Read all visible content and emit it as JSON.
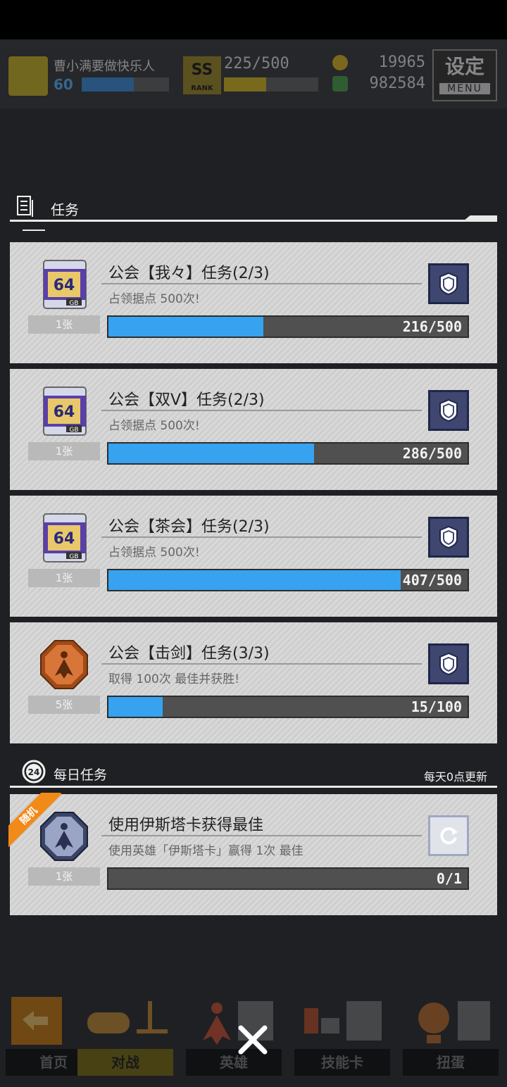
{
  "header": {
    "user_name": "曹小满要做快乐人",
    "level": "60",
    "rank_badge": "SS",
    "rank_label": "RANK",
    "rank_progress": "225/500",
    "coins": "19965",
    "gems": "982584",
    "settings_label": "设定",
    "settings_sub": "MENU"
  },
  "section": {
    "title": "任务"
  },
  "tasks": [
    {
      "title": "公会【我々】任务(2/3)",
      "desc": "占领据点 500次!",
      "reward_count": "1张",
      "progress_text": "216/500",
      "progress": 0.432,
      "reward_type": "gb-card-icon"
    },
    {
      "title": "公会【双V】任务(2/3)",
      "desc": "占领据点 500次!",
      "reward_count": "1张",
      "progress_text": "286/500",
      "progress": 0.572,
      "reward_type": "gb-card-icon"
    },
    {
      "title": "公会【茶会】任务(2/3)",
      "desc": "占领据点 500次!",
      "reward_count": "1张",
      "progress_text": "407/500",
      "progress": 0.814,
      "reward_type": "gb-card-icon"
    },
    {
      "title": "公会【击剑】任务(3/3)",
      "desc": "取得 100次 最佳并获胜!",
      "reward_count": "5张",
      "progress_text": "15/100",
      "progress": 0.15,
      "reward_type": "bronze-medal-icon"
    }
  ],
  "daily": {
    "title": "每日任务",
    "note": "每天0点更新",
    "task": {
      "ribbon": "随机",
      "title": "使用伊斯塔卡获得最佳",
      "desc": "使用英雄「伊斯塔卡」赢得 1次 最佳",
      "reward_count": "1张",
      "progress_text": "0/1",
      "progress": 0
    }
  },
  "nav": [
    {
      "label": "首页"
    },
    {
      "label": "对战"
    },
    {
      "label": "英雄"
    },
    {
      "label": "技能卡"
    },
    {
      "label": "扭蛋"
    }
  ],
  "colors": {
    "progress_fill": "#36a2f0",
    "ribbon": "#f28a19"
  }
}
